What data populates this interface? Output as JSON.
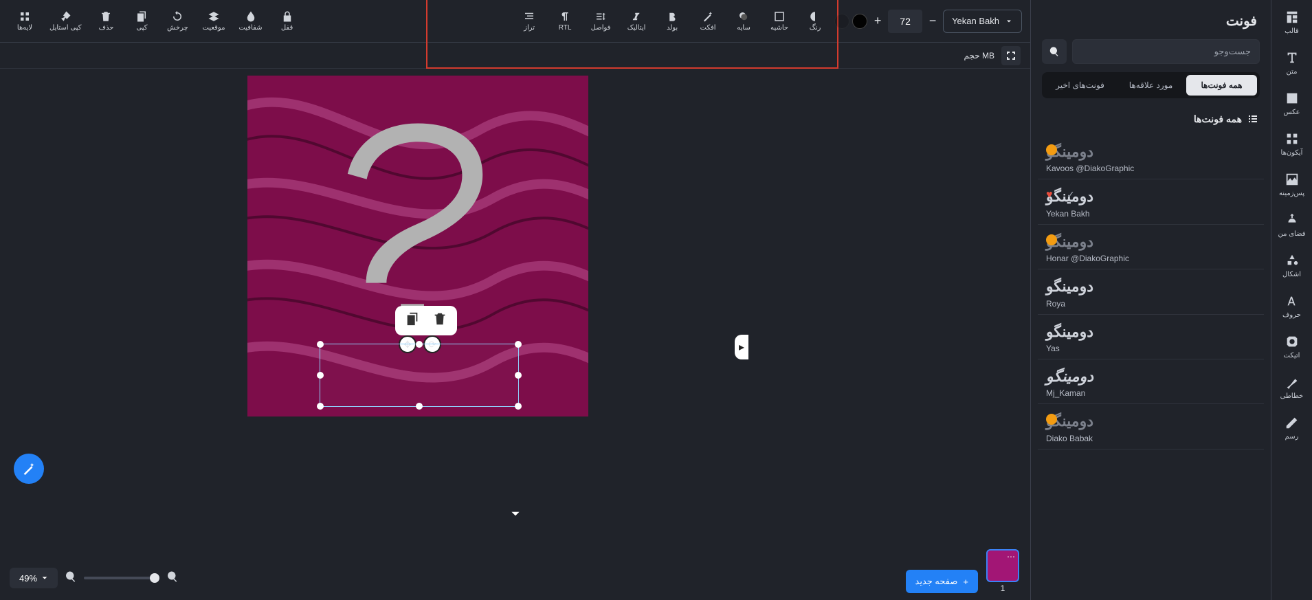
{
  "rail": [
    {
      "id": "template",
      "label": "قالب"
    },
    {
      "id": "text",
      "label": "متن"
    },
    {
      "id": "image",
      "label": "عکس"
    },
    {
      "id": "icons",
      "label": "آیکون‌ها"
    },
    {
      "id": "background",
      "label": "پس‌زمینه"
    },
    {
      "id": "myspace",
      "label": "فضای من"
    },
    {
      "id": "shapes",
      "label": "اشکال"
    },
    {
      "id": "letters",
      "label": "حروف"
    },
    {
      "id": "sticker",
      "label": "اتیکت"
    },
    {
      "id": "calligraphy",
      "label": "خطاطی"
    },
    {
      "id": "draw",
      "label": "رسم"
    }
  ],
  "panel": {
    "title": "فونت",
    "search_placeholder": "جست‌وجو",
    "tabs": [
      {
        "id": "all",
        "label": "همه فونت‌ها",
        "active": true
      },
      {
        "id": "fav",
        "label": "مورد علاقه‌ها",
        "active": false
      },
      {
        "id": "recent",
        "label": "فونت‌های اخیر",
        "active": false
      }
    ],
    "list_title": "همه فونت‌ها",
    "fonts": [
      {
        "preview": "دومینگو",
        "name": "Kavoos @DiakoGraphic",
        "premium": true,
        "active": false,
        "light": true
      },
      {
        "preview": "دومینگو",
        "name": "Yekan Bakh",
        "heart": true,
        "check": true,
        "active": true
      },
      {
        "preview": "دومینگو",
        "name": "Honar @DiakoGraphic",
        "premium": true,
        "light": true
      },
      {
        "preview": "دومینگو",
        "name": "Roya"
      },
      {
        "preview": "دومینگو",
        "name": "Yas",
        "serif": true
      },
      {
        "preview": "دومینگو",
        "name": "Mj_Kaman",
        "script": true
      },
      {
        "preview": "دومینگو",
        "name": "Diako Babak",
        "premium": true,
        "light": true
      }
    ]
  },
  "text_toolbar": {
    "font_name": "Yekan Bakh",
    "size": "72",
    "subbar": "حجم MB",
    "buttons": {
      "rang": "رنگ",
      "hashie": "حاشیه",
      "saye": "سایه",
      "effect": "افکت",
      "bold": "بولد",
      "italic": "ایتالیک",
      "spacing": "فواصل",
      "rtl": "RTL",
      "align": "تراز"
    }
  },
  "main_toolbar": {
    "lock": "قفل",
    "opacity": "شفافیت",
    "position": "موقعیت",
    "rotate": "چرخش",
    "copy": "کپی",
    "delete": "حذف",
    "copy_style": "کپی استایل",
    "layers": "لایه‌ها"
  },
  "bottom": {
    "zoom": "49%",
    "new_page": "صفحه جدید",
    "page_num": "1"
  }
}
